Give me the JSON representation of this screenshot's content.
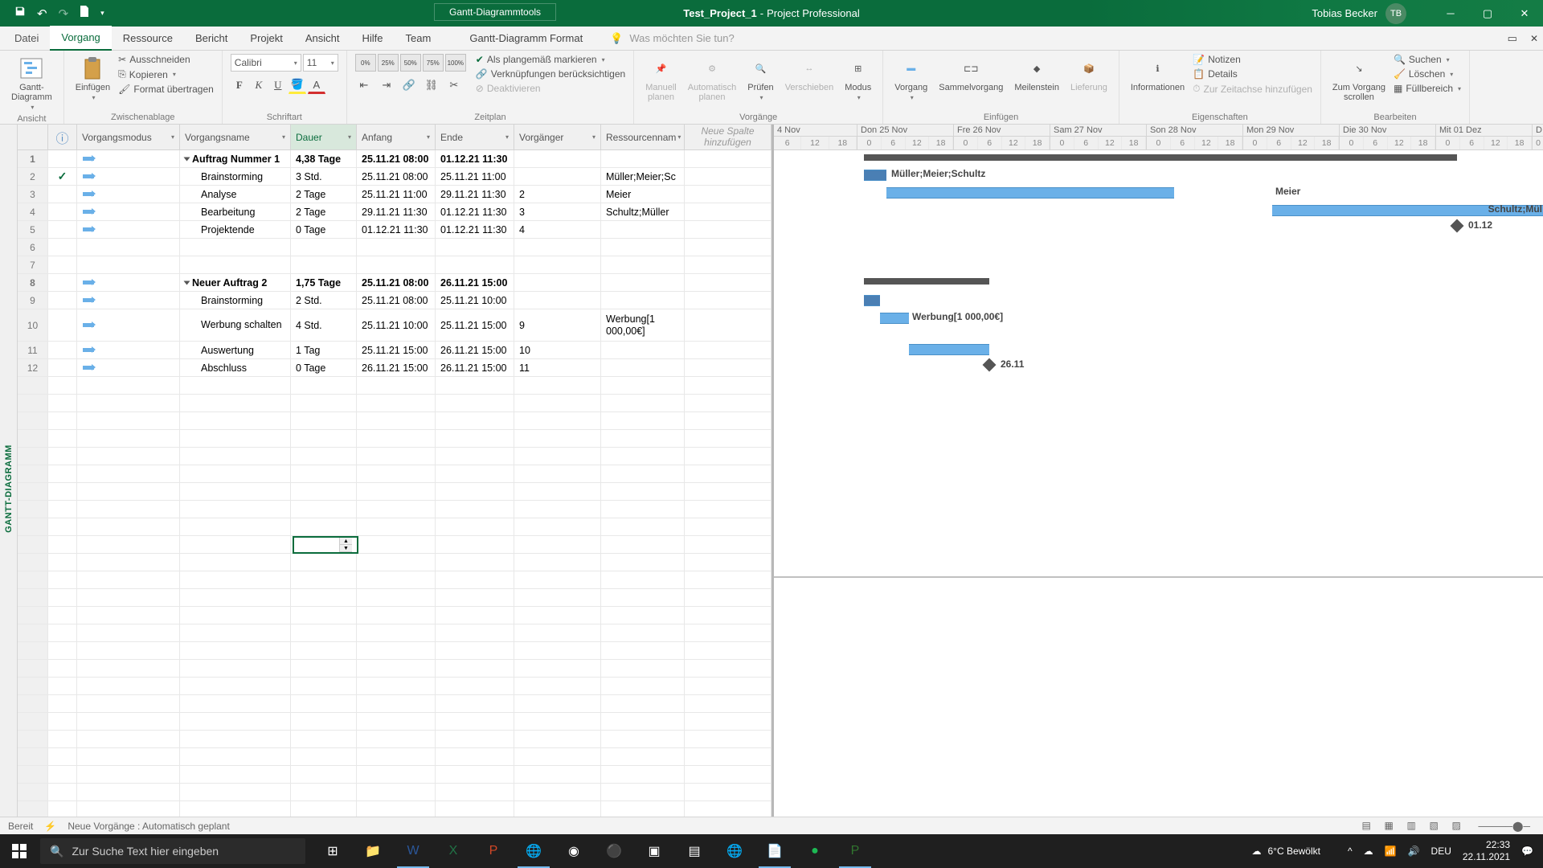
{
  "titlebar": {
    "tools_label": "Gantt-Diagrammtools",
    "doc": "Test_Project_1",
    "app": "Project Professional",
    "sep": "  -  ",
    "user": "Tobias Becker",
    "initials": "TB"
  },
  "tabs": {
    "file": "Datei",
    "task": "Vorgang",
    "resource": "Ressource",
    "report": "Bericht",
    "project": "Projekt",
    "view": "Ansicht",
    "help": "Hilfe",
    "team": "Team",
    "format": "Gantt-Diagramm Format",
    "search_ph": "Was möchten Sie tun?"
  },
  "ribbon": {
    "view": {
      "gantt": "Gantt-\nDiagramm",
      "group": "Ansicht"
    },
    "clipboard": {
      "paste": "Einfügen",
      "cut": "Ausschneiden",
      "copy": "Kopieren",
      "fmt": "Format übertragen",
      "group": "Zwischenablage"
    },
    "font": {
      "name": "Calibri",
      "size": "11",
      "b": "F",
      "i": "K",
      "u": "U",
      "group": "Schriftart"
    },
    "schedule": {
      "ontrack": "Als plangemäß markieren",
      "links": "Verknüpfungen berücksichtigen",
      "deact": "Deaktivieren",
      "group": "Zeitplan"
    },
    "tasks": {
      "manual": "Manuell\nplanen",
      "auto": "Automatisch\nplanen",
      "inspect": "Prüfen",
      "move": "Verschieben",
      "mode": "Modus",
      "group": "Vorgänge"
    },
    "insert": {
      "task": "Vorgang",
      "summary": "Sammelvorgang",
      "milestone": "Meilenstein",
      "deliv": "Lieferung",
      "group": "Einfügen"
    },
    "props": {
      "info": "Informationen",
      "notes": "Notizen",
      "details": "Details",
      "timeline": "Zur Zeitachse hinzufügen",
      "group": "Eigenschaften"
    },
    "edit": {
      "scroll": "Zum Vorgang\nscrollen",
      "find": "Suchen",
      "clear": "Löschen",
      "fill": "Füllbereich",
      "group": "Bearbeiten"
    }
  },
  "vlabel": "GANTT-DIAGRAMM",
  "cols": {
    "info": "ⓘ",
    "mode": "Vorgangsmodus",
    "name": "Vorgangsname",
    "dur": "Dauer",
    "start": "Anfang",
    "end": "Ende",
    "pred": "Vorgänger",
    "res": "Ressourcennam",
    "add": "Neue Spalte hinzufügen"
  },
  "rows": [
    {
      "n": "1",
      "summary": true,
      "name": "Auftrag Nummer 1",
      "dur": "4,38 Tage",
      "start": "25.11.21 08:00",
      "end": "01.12.21 11:30",
      "pred": "",
      "res": ""
    },
    {
      "n": "2",
      "done": true,
      "name": "Brainstorming",
      "dur": "3 Std.",
      "start": "25.11.21 08:00",
      "end": "25.11.21 11:00",
      "pred": "",
      "res": "Müller;Meier;Sc"
    },
    {
      "n": "3",
      "name": "Analyse",
      "dur": "2 Tage",
      "start": "25.11.21 11:00",
      "end": "29.11.21 11:30",
      "pred": "2",
      "res": "Meier"
    },
    {
      "n": "4",
      "name": "Bearbeitung",
      "dur": "2 Tage",
      "start": "29.11.21 11:30",
      "end": "01.12.21 11:30",
      "pred": "3",
      "res": "Schultz;Müller"
    },
    {
      "n": "5",
      "name": "Projektende",
      "dur": "0 Tage",
      "start": "01.12.21 11:30",
      "end": "01.12.21 11:30",
      "pred": "4",
      "res": ""
    },
    {
      "n": "6",
      "blank": true
    },
    {
      "n": "7",
      "blank": true
    },
    {
      "n": "8",
      "summary": true,
      "name": "Neuer Auftrag 2",
      "dur": "1,75 Tage",
      "start": "25.11.21 08:00",
      "end": "26.11.21 15:00",
      "pred": "",
      "res": ""
    },
    {
      "n": "9",
      "name": "Brainstorming",
      "dur": "2 Std.",
      "start": "25.11.21 08:00",
      "end": "25.11.21 10:00",
      "pred": "",
      "res": ""
    },
    {
      "n": "10",
      "tall": true,
      "name": "Werbung schalten",
      "dur": "4 Std.",
      "start": "25.11.21 10:00",
      "end": "25.11.21 15:00",
      "pred": "9",
      "res": "Werbung[1 000,00€]"
    },
    {
      "n": "11",
      "name": "Auswertung",
      "dur": "1 Tag",
      "start": "25.11.21 15:00",
      "end": "26.11.21 15:00",
      "pred": "10",
      "res": ""
    },
    {
      "n": "12",
      "name": "Abschluss",
      "dur": "0 Tage",
      "start": "26.11.21 15:00",
      "end": "26.11.21 15:00",
      "pred": "11",
      "res": ""
    }
  ],
  "timeline_days": [
    "4 Nov",
    "Don 25 Nov",
    "Fre 26 Nov",
    "Sam 27 Nov",
    "Son 28 Nov",
    "Mon 29 Nov",
    "Die 30 Nov",
    "Mit 01 Dez",
    "D"
  ],
  "timeline_hours": [
    "6",
    "12",
    "18",
    "0",
    "6",
    "12",
    "18",
    "0",
    "6",
    "12",
    "18",
    "0",
    "6",
    "12",
    "18",
    "0",
    "6",
    "12",
    "18",
    "0",
    "6",
    "12",
    "18",
    "0",
    "6",
    "12",
    "18",
    "0",
    "6",
    "12",
    "18"
  ],
  "gantt_labels": {
    "r2": "Müller;Meier;Schultz",
    "r3": "Meier",
    "r4": "Schultz;Mül",
    "r5": "01.12",
    "r10": "Werbung[1 000,00€]",
    "r12": "26.11"
  },
  "status": {
    "ready": "Bereit",
    "mode": "Neue Vorgänge : Automatisch geplant"
  },
  "taskbar": {
    "search": "Zur Suche Text hier eingeben",
    "weather": "6°C  Bewölkt",
    "time": "22:33",
    "date": "22.11.2021",
    "lang": "DEU"
  }
}
